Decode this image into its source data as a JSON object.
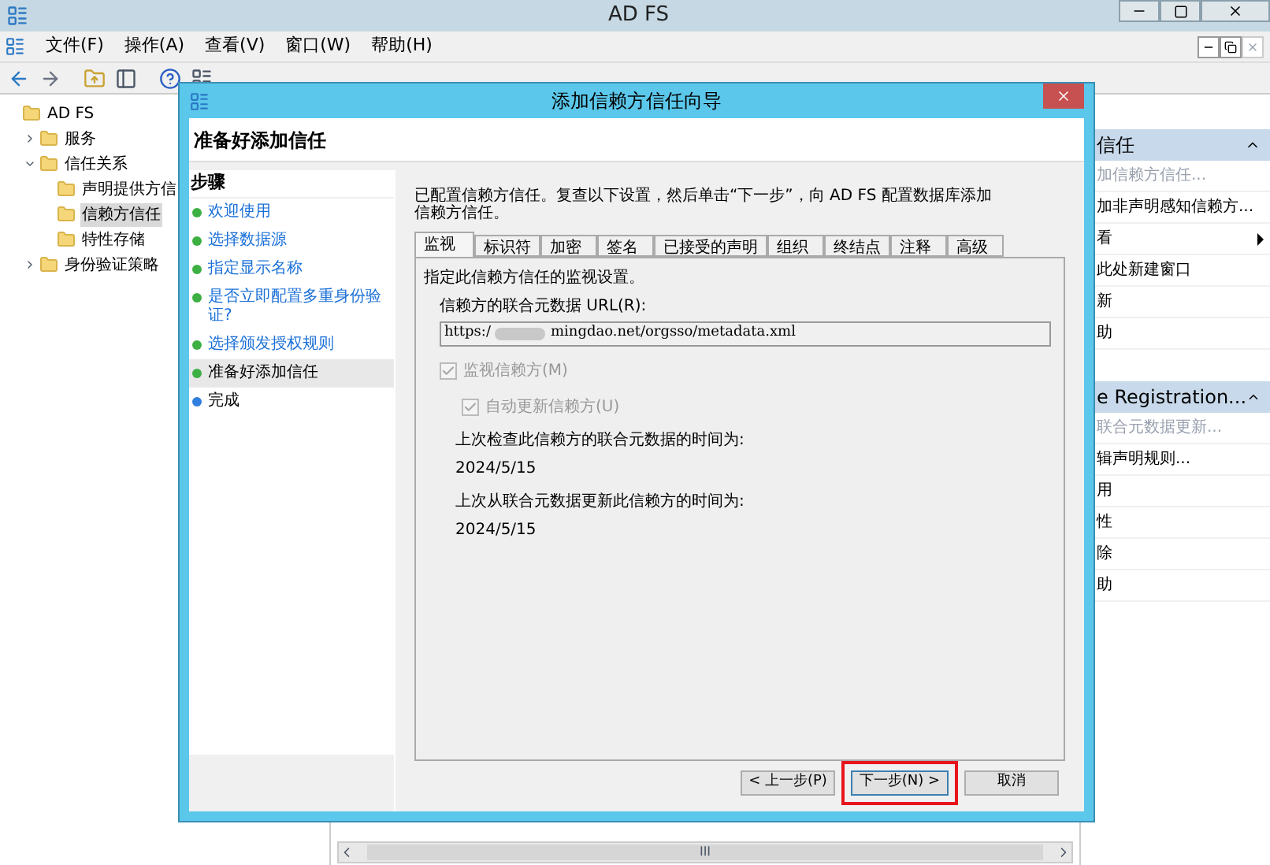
{
  "window": {
    "title": "AD FS"
  },
  "menu": [
    "文件(F)",
    "操作(A)",
    "查看(V)",
    "窗口(W)",
    "帮助(H)"
  ],
  "tree": [
    {
      "label": "AD FS",
      "selected": false,
      "children": [
        {
          "label": "服务",
          "expanded": false,
          "selected": false
        },
        {
          "label": "信任关系",
          "expanded": true,
          "selected": false,
          "children": [
            {
              "label": "声明提供方信",
              "selected": false
            },
            {
              "label": "信赖方信任",
              "selected": true
            },
            {
              "label": "特性存储",
              "selected": false
            }
          ]
        },
        {
          "label": "身份验证策略",
          "expanded": false,
          "selected": false
        }
      ]
    }
  ],
  "actions": [
    {
      "title": "信任",
      "items": [
        {
          "label": "加信赖方信任...",
          "disabled": true,
          "submenu": false
        },
        {
          "label": "加非声明感知信赖方...",
          "disabled": false,
          "submenu": false
        },
        {
          "label": "看",
          "disabled": false,
          "submenu": true
        },
        {
          "label": "此处新建窗口",
          "disabled": false,
          "submenu": false
        },
        {
          "label": "新",
          "disabled": false,
          "submenu": false
        },
        {
          "label": "助",
          "disabled": false,
          "submenu": false
        }
      ]
    },
    {
      "title": "e Registration...",
      "items": [
        {
          "label": "联合元数据更新...",
          "disabled": true,
          "submenu": false
        },
        {
          "label": "辑声明规则...",
          "disabled": false,
          "submenu": false
        },
        {
          "label": "用",
          "disabled": false,
          "submenu": false
        },
        {
          "label": "性",
          "disabled": false,
          "submenu": false
        },
        {
          "label": "除",
          "disabled": false,
          "submenu": false
        },
        {
          "label": "助",
          "disabled": false,
          "submenu": false
        }
      ]
    }
  ],
  "dialog": {
    "title": "添加信赖方信任向导",
    "heading": "准备好添加信任",
    "steps_title": "步骤",
    "steps": [
      {
        "label": "欢迎使用",
        "kind": "link",
        "selected": false,
        "color": "#3cb043"
      },
      {
        "label": "选择数据源",
        "kind": "link",
        "selected": false,
        "color": "#3cb043"
      },
      {
        "label": "指定显示名称",
        "kind": "link",
        "selected": false,
        "color": "#3cb043"
      },
      {
        "label": "是否立即配置多重身份验证?",
        "kind": "link",
        "selected": false,
        "color": "#3cb043"
      },
      {
        "label": "选择颁发授权规则",
        "kind": "link",
        "selected": false,
        "color": "#3cb043"
      },
      {
        "label": "准备好添加信任",
        "kind": "plain",
        "selected": true,
        "color": "#3cb043"
      },
      {
        "label": "完成",
        "kind": "plain",
        "selected": false,
        "color": "#2f7fe0"
      }
    ],
    "intro": "已配置信赖方信任。复查以下设置，然后单击“下一步”，向 AD FS 配置数据库添加信赖方信任。",
    "tabs": [
      {
        "label": "监视",
        "selected": true
      },
      {
        "label": "标识符",
        "selected": false
      },
      {
        "label": "加密",
        "selected": false
      },
      {
        "label": "签名",
        "selected": false
      },
      {
        "label": "已接受的声明",
        "selected": false
      },
      {
        "label": "组织",
        "selected": false
      },
      {
        "label": "终结点",
        "selected": false
      },
      {
        "label": "注释",
        "selected": false
      },
      {
        "label": "高级",
        "selected": false
      }
    ],
    "tab_description": "指定此信赖方信任的监视设置。",
    "url_label": "信赖方的联合元数据 URL(R):",
    "url_start": "https:/",
    "url_end": "mingdao.net/orgsso/metadata.xml",
    "checkboxes": [
      {
        "label": "监视信赖方(M)",
        "checked": true,
        "disabled": true,
        "children": [
          {
            "label": "自动更新信赖方(U)",
            "checked": true,
            "disabled": true
          }
        ]
      }
    ],
    "infos": [
      {
        "label": "上次检查此信赖方的联合元数据的时间为:",
        "value": "2024/5/15"
      },
      {
        "label": "上次从联合元数据更新此信赖方的时间为:",
        "value": "2024/5/15"
      }
    ],
    "buttons": [
      {
        "label": "< 上一步(P)",
        "highlighted": false
      },
      {
        "label": "下一步(N) >",
        "highlighted": true
      },
      {
        "label": "取消",
        "highlighted": false
      }
    ]
  },
  "scrollbar": {
    "grip": "III"
  }
}
